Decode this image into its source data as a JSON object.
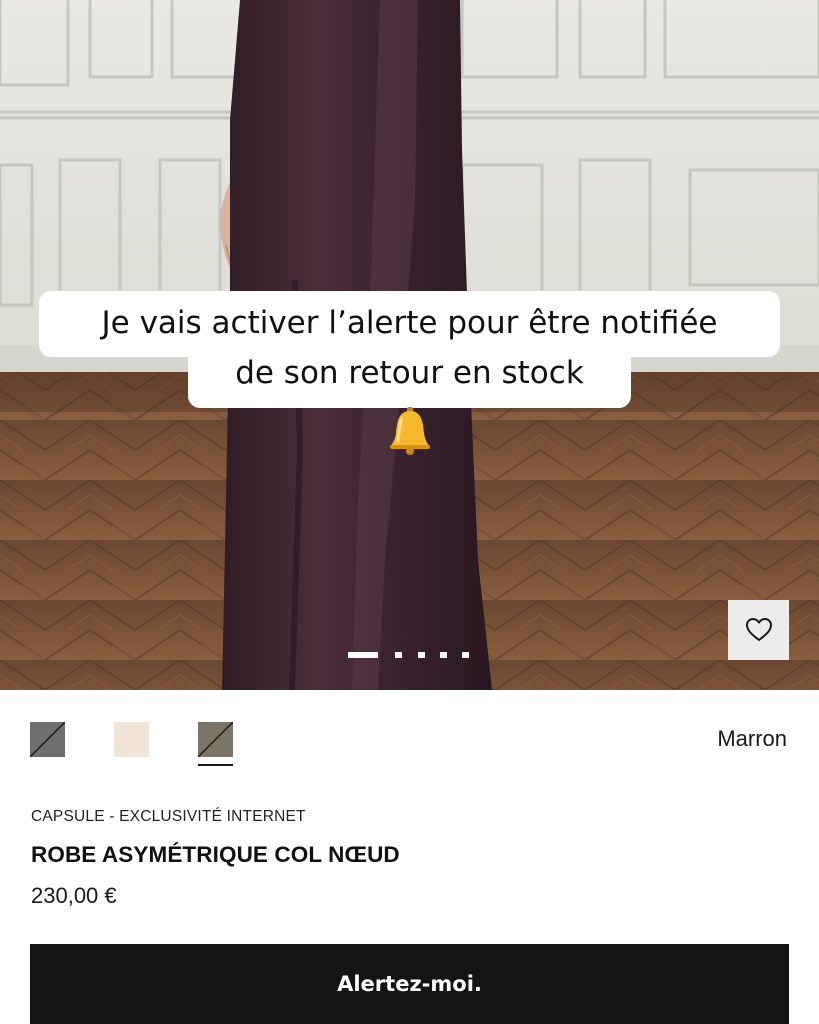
{
  "caption": {
    "line1": "Je vais activer l’alerte pour être notifiée",
    "line2": "de son retour en stock"
  },
  "gallery": {
    "icons": {
      "bell": "bell-emoji-icon",
      "wishlist": "heart-icon"
    },
    "slide_count": 5,
    "active_slide": 1
  },
  "swatches": {
    "items": [
      {
        "color": "#6f6f6f",
        "crossed": true
      },
      {
        "color": "#f1e3d5",
        "crossed": false
      },
      {
        "color": "#7d7568",
        "crossed": true
      }
    ],
    "selected_index": 2,
    "selected_label": "Marron"
  },
  "product": {
    "collection": "CAPSULE - EXCLUSIVITÉ INTERNET",
    "name": "ROBE ASYMÉTRIQUE COL NŒUD",
    "price": "230,00 €"
  },
  "cta": {
    "label": "Alertez-moi."
  },
  "colors": {
    "dress": "#3d2530",
    "button_bg": "#141414",
    "wall": "#e6e5df",
    "floor": "#7a5236"
  }
}
